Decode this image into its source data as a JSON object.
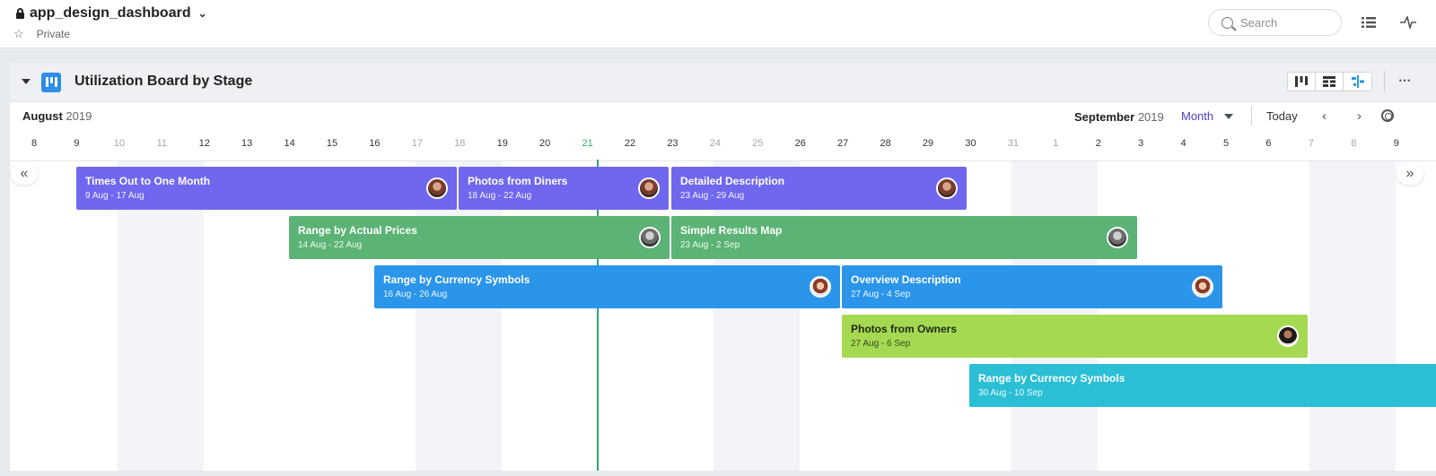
{
  "header": {
    "project_name": "app_design_dashboard",
    "visibility": "Private",
    "search_placeholder": "Search"
  },
  "board": {
    "title": "Utilization Board by Stage",
    "left_month": "August",
    "left_year": "2019",
    "right_month": "September",
    "right_year": "2019",
    "scale": "Month",
    "today_label": "Today",
    "days": [
      "8",
      "9",
      "10",
      "11",
      "12",
      "13",
      "14",
      "15",
      "16",
      "17",
      "18",
      "19",
      "20",
      "21",
      "22",
      "23",
      "24",
      "25",
      "26",
      "27",
      "28",
      "29",
      "30",
      "31",
      "1",
      "2",
      "3",
      "4",
      "5",
      "6",
      "7",
      "8",
      "9"
    ],
    "today_day": "21"
  },
  "tasks": [
    {
      "title": "Times Out to One Month",
      "dates": "9 Aug - 17 Aug"
    },
    {
      "title": "Photos from Diners",
      "dates": "18 Aug - 22 Aug"
    },
    {
      "title": "Detailed Description",
      "dates": "23 Aug - 29 Aug"
    },
    {
      "title": "Range by Actual Prices",
      "dates": "14 Aug - 22 Aug"
    },
    {
      "title": "Simple Results Map",
      "dates": "23 Aug - 2 Sep"
    },
    {
      "title": "Range by Currency Symbols",
      "dates": "16 Aug - 26 Aug"
    },
    {
      "title": "Overview Description",
      "dates": "27 Aug - 4 Sep"
    },
    {
      "title": "Photos from Owners",
      "dates": "27 Aug - 6 Sep"
    },
    {
      "title": "Range by Currency Symbols",
      "dates": "30 Aug - 10 Sep"
    }
  ],
  "colors": {
    "purple": "#7067ef",
    "green": "#5bb375",
    "blue": "#2b95ea",
    "lime": "#a6d952",
    "cyan": "#2bbfd5",
    "today": "#2ea86b"
  }
}
